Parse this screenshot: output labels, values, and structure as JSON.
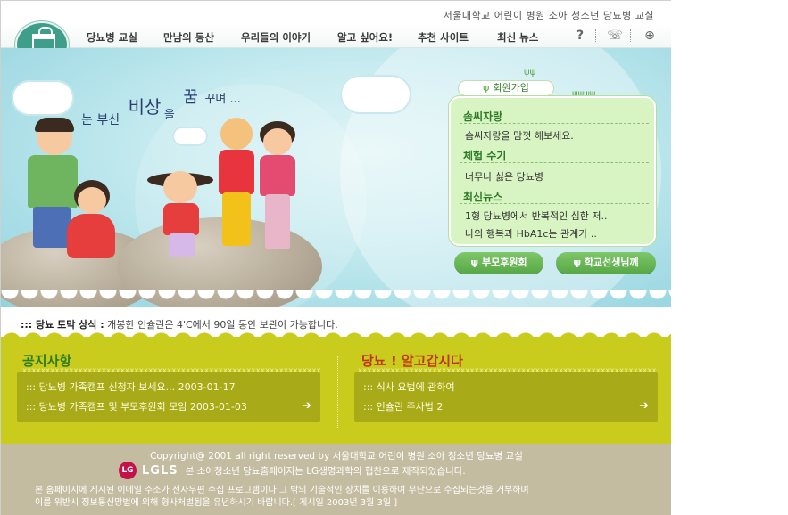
{
  "header": {
    "title": "서울대학교 어린이 병원 소아 청소년 당뇨병 교실"
  },
  "nav": {
    "items": [
      {
        "label": "당뇨병 교실"
      },
      {
        "label": "만남의 동산"
      },
      {
        "label": "우리들의 이야기"
      },
      {
        "label": "알고 싶어요!"
      },
      {
        "label": "추천 사이트"
      },
      {
        "label": "최신 뉴스"
      }
    ],
    "tools": [
      "?",
      "☏",
      "⊕"
    ]
  },
  "hero": {
    "slogan_1": "눈 부신",
    "slogan_2": "비상",
    "slogan_3": "을",
    "slogan_4": "꿈",
    "slogan_5": "꾸며 ..."
  },
  "panel": {
    "join_label": "회원가입",
    "sections": [
      {
        "title": "솜씨자랑",
        "items": [
          "솜씨자랑을 맘껏 해보세요."
        ]
      },
      {
        "title": "체험 수기",
        "items": [
          "너무나 싫은 당뇨병"
        ]
      },
      {
        "title": "최신뉴스",
        "items": [
          "1형 당뇨병에서 반복적인 심한 저..",
          "나의 행복과 HbA1c는 관계가 .."
        ]
      }
    ],
    "buttons": [
      "부모후원회",
      "학교선생님께"
    ]
  },
  "ticker": {
    "prefix": "::: 당뇨 토막 상식 :",
    "text": "개봉한 인슐린은 4'C에서 90일 동안 보관이 가능합니다."
  },
  "board": {
    "notice": {
      "title": "공지사항",
      "rows": [
        "::: 당뇨병 가족캠프 신청자 보세요... 2003-01-17",
        "::: 당뇨병 가족캠프 및 부모후원회 모임 2003-01-03"
      ]
    },
    "learn": {
      "title": "당뇨 ! 알고갑시다",
      "rows": [
        "::: 식사 요법에 관하여",
        "::: 인슐린 주사법 2"
      ]
    },
    "arrow": "➔"
  },
  "footer": {
    "copyright": "Copyright@ 2001 all right reserved by 서울대학교 어린이 병원 소아 청소년 당뇨병 교실",
    "lg_mark": "LG",
    "lg_text": "LGLS",
    "lg_desc": "본 소아청소년 당뇨홈페이지는 LG생명과학의 협찬으로 제작되었습니다.",
    "notice_1": "본 홈페이지에 게시된 이메일 주소가 전자우편 수집 프로그램이나 그 밖의 기술적인 장치를 이용하여 무단으로 수집되는것을 거부하며",
    "notice_2": "이를 위반시 정보통신망법에 의해 형사처벌됨을 유념하시기 바랍니다.[ 게시일 2003년 3월 3일 ]"
  },
  "colors": {
    "hero_bg": "#a8dde6",
    "panel_bg": "#d8f4c2",
    "board_bg": "#c9cc1c",
    "footer_bg": "#c4bca0"
  }
}
